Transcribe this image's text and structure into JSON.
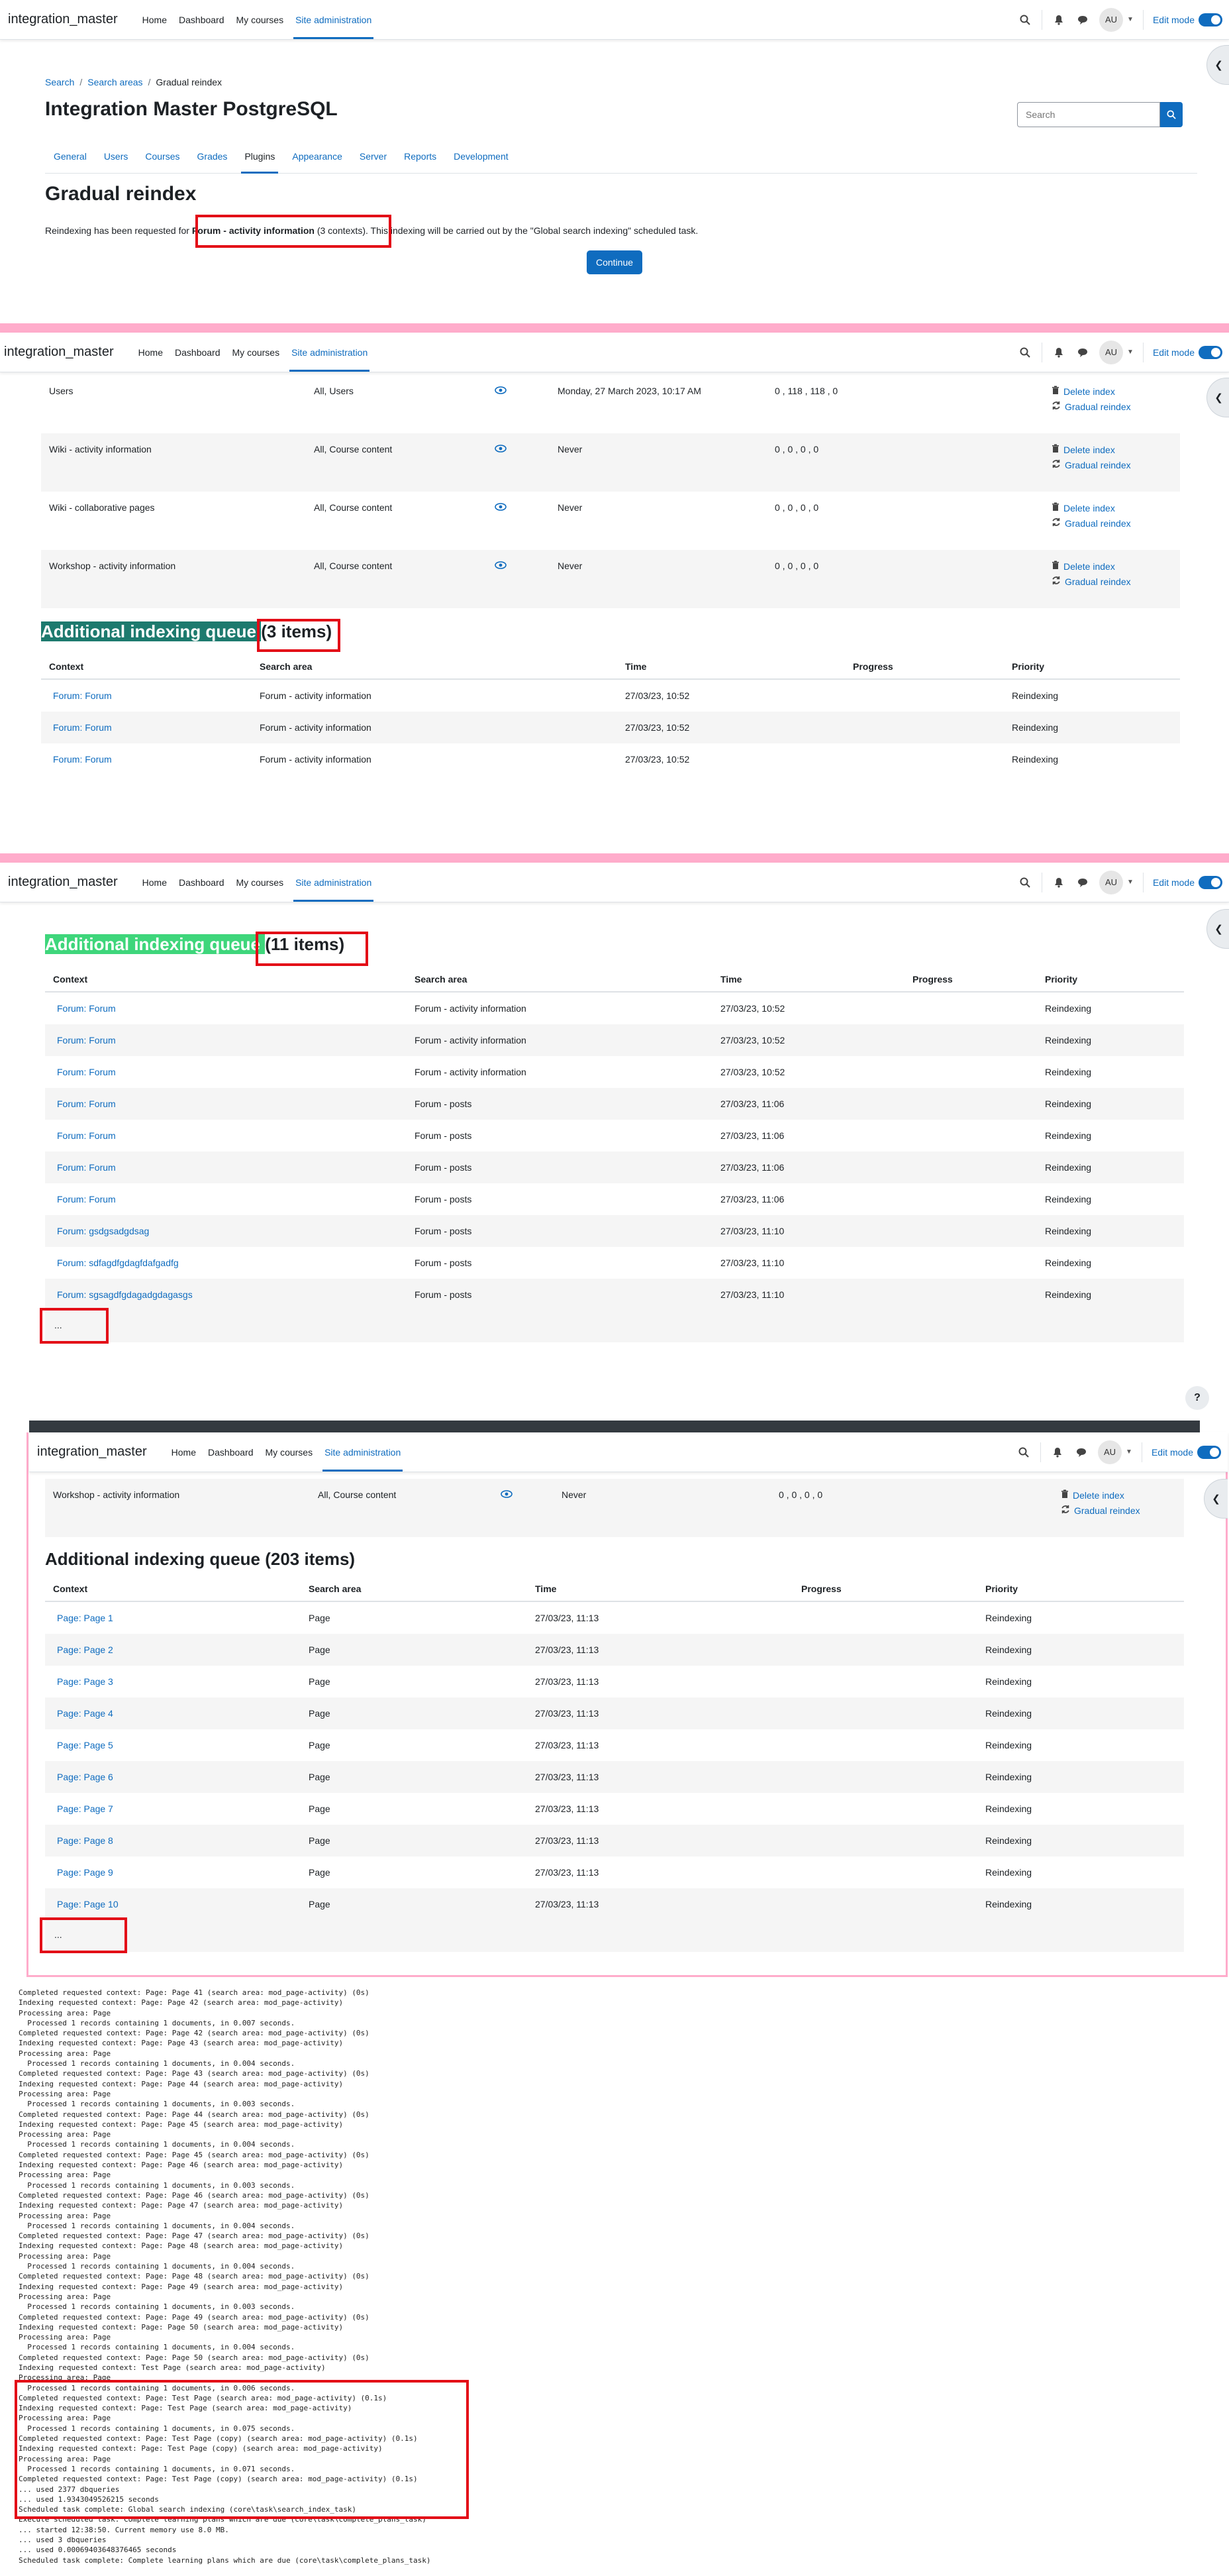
{
  "nav": {
    "brand": "integration_master",
    "links": [
      "Home",
      "Dashboard",
      "My courses",
      "Site administration"
    ],
    "avatar": "AU",
    "edit_mode": "Edit mode"
  },
  "breadcrumb": [
    "Search",
    "Search areas",
    "Gradual reindex"
  ],
  "page_title": "Integration Master PostgreSQL",
  "search": {
    "placeholder": "Search"
  },
  "secondary_nav": [
    "General",
    "Users",
    "Courses",
    "Grades",
    "Plugins",
    "Appearance",
    "Server",
    "Reports",
    "Development"
  ],
  "gradual": {
    "title": "Gradual reindex",
    "msg_pre": "Reindexing has been requested for ",
    "msg_area": "Forum - activity information",
    "msg_contexts": " (3 contexts)",
    "msg_post": ". This indexing will be carried out by the \"Global search indexing\" scheduled task.",
    "continue": "Continue"
  },
  "actions": {
    "delete": "Delete index",
    "gradual": "Gradual reindex"
  },
  "area_rows": [
    {
      "area": "Users",
      "enabled": "All, Users",
      "last": "Monday, 27 March 2023, 10:17 AM",
      "counts": "0 , 118 , 118 , 0"
    },
    {
      "area": "Wiki - activity information",
      "enabled": "All, Course content",
      "last": "Never",
      "counts": "0 , 0 , 0 , 0"
    },
    {
      "area": "Wiki - collaborative pages",
      "enabled": "All, Course content",
      "last": "Never",
      "counts": "0 , 0 , 0 , 0"
    },
    {
      "area": "Workshop - activity information",
      "enabled": "All, Course content",
      "last": "Never",
      "counts": "0 , 0 , 0 , 0"
    }
  ],
  "queue_headers": [
    "Context",
    "Search area",
    "Time",
    "Progress",
    "Priority"
  ],
  "queue1": {
    "title_pre": "Additional indexing queue ",
    "title_count": "(3 items)",
    "rows": [
      {
        "context": "Forum: Forum",
        "area": "Forum - activity information",
        "time": "27/03/23, 10:52",
        "progress": "",
        "priority": "Reindexing"
      },
      {
        "context": "Forum: Forum",
        "area": "Forum - activity information",
        "time": "27/03/23, 10:52",
        "progress": "",
        "priority": "Reindexing"
      },
      {
        "context": "Forum: Forum",
        "area": "Forum - activity information",
        "time": "27/03/23, 10:52",
        "progress": "",
        "priority": "Reindexing"
      }
    ]
  },
  "queue2": {
    "title_pre": "Additional indexing queue ",
    "title_count": "(11 items)",
    "rows": [
      {
        "context": "Forum: Forum",
        "area": "Forum - activity information",
        "time": "27/03/23, 10:52",
        "progress": "",
        "priority": "Reindexing"
      },
      {
        "context": "Forum: Forum",
        "area": "Forum - activity information",
        "time": "27/03/23, 10:52",
        "progress": "",
        "priority": "Reindexing"
      },
      {
        "context": "Forum: Forum",
        "area": "Forum - activity information",
        "time": "27/03/23, 10:52",
        "progress": "",
        "priority": "Reindexing"
      },
      {
        "context": "Forum: Forum",
        "area": "Forum - posts",
        "time": "27/03/23, 11:06",
        "progress": "",
        "priority": "Reindexing"
      },
      {
        "context": "Forum: Forum",
        "area": "Forum - posts",
        "time": "27/03/23, 11:06",
        "progress": "",
        "priority": "Reindexing"
      },
      {
        "context": "Forum: Forum",
        "area": "Forum - posts",
        "time": "27/03/23, 11:06",
        "progress": "",
        "priority": "Reindexing"
      },
      {
        "context": "Forum: Forum",
        "area": "Forum - posts",
        "time": "27/03/23, 11:06",
        "progress": "",
        "priority": "Reindexing"
      },
      {
        "context": "Forum: gsdgsadgdsag",
        "area": "Forum - posts",
        "time": "27/03/23, 11:10",
        "progress": "",
        "priority": "Reindexing"
      },
      {
        "context": "Forum: sdfagdfgdagfdafgadfg",
        "area": "Forum - posts",
        "time": "27/03/23, 11:10",
        "progress": "",
        "priority": "Reindexing"
      },
      {
        "context": "Forum: sgsagdfgdagadgdagasgs",
        "area": "Forum - posts",
        "time": "27/03/23, 11:10",
        "progress": "",
        "priority": "Reindexing"
      }
    ],
    "more": "..."
  },
  "queue3": {
    "title": "Additional indexing queue (203 items)",
    "rows": [
      {
        "context": "Page: Page 1",
        "area": "Page",
        "time": "27/03/23, 11:13",
        "progress": "",
        "priority": "Reindexing"
      },
      {
        "context": "Page: Page 2",
        "area": "Page",
        "time": "27/03/23, 11:13",
        "progress": "",
        "priority": "Reindexing"
      },
      {
        "context": "Page: Page 3",
        "area": "Page",
        "time": "27/03/23, 11:13",
        "progress": "",
        "priority": "Reindexing"
      },
      {
        "context": "Page: Page 4",
        "area": "Page",
        "time": "27/03/23, 11:13",
        "progress": "",
        "priority": "Reindexing"
      },
      {
        "context": "Page: Page 5",
        "area": "Page",
        "time": "27/03/23, 11:13",
        "progress": "",
        "priority": "Reindexing"
      },
      {
        "context": "Page: Page 6",
        "area": "Page",
        "time": "27/03/23, 11:13",
        "progress": "",
        "priority": "Reindexing"
      },
      {
        "context": "Page: Page 7",
        "area": "Page",
        "time": "27/03/23, 11:13",
        "progress": "",
        "priority": "Reindexing"
      },
      {
        "context": "Page: Page 8",
        "area": "Page",
        "time": "27/03/23, 11:13",
        "progress": "",
        "priority": "Reindexing"
      },
      {
        "context": "Page: Page 9",
        "area": "Page",
        "time": "27/03/23, 11:13",
        "progress": "",
        "priority": "Reindexing"
      },
      {
        "context": "Page: Page 10",
        "area": "Page",
        "time": "27/03/23, 11:13",
        "progress": "",
        "priority": "Reindexing"
      }
    ],
    "more": "..."
  },
  "help": "?",
  "log_lines": [
    "Completed requested context: Page: Page 41 (search area: mod_page-activity) (0s)",
    "Indexing requested context: Page: Page 42 (search area: mod_page-activity)",
    "Processing area: Page",
    "  Processed 1 records containing 1 documents, in 0.007 seconds.",
    "Completed requested context: Page: Page 42 (search area: mod_page-activity) (0s)",
    "Indexing requested context: Page: Page 43 (search area: mod_page-activity)",
    "Processing area: Page",
    "  Processed 1 records containing 1 documents, in 0.004 seconds.",
    "Completed requested context: Page: Page 43 (search area: mod_page-activity) (0s)",
    "Indexing requested context: Page: Page 44 (search area: mod_page-activity)",
    "Processing area: Page",
    "  Processed 1 records containing 1 documents, in 0.003 seconds.",
    "Completed requested context: Page: Page 44 (search area: mod_page-activity) (0s)",
    "Indexing requested context: Page: Page 45 (search area: mod_page-activity)",
    "Processing area: Page",
    "  Processed 1 records containing 1 documents, in 0.004 seconds.",
    "Completed requested context: Page: Page 45 (search area: mod_page-activity) (0s)",
    "Indexing requested context: Page: Page 46 (search area: mod_page-activity)",
    "Processing area: Page",
    "  Processed 1 records containing 1 documents, in 0.003 seconds.",
    "Completed requested context: Page: Page 46 (search area: mod_page-activity) (0s)",
    "Indexing requested context: Page: Page 47 (search area: mod_page-activity)",
    "Processing area: Page",
    "  Processed 1 records containing 1 documents, in 0.004 seconds.",
    "Completed requested context: Page: Page 47 (search area: mod_page-activity) (0s)",
    "Indexing requested context: Page: Page 48 (search area: mod_page-activity)",
    "Processing area: Page",
    "  Processed 1 records containing 1 documents, in 0.004 seconds.",
    "Completed requested context: Page: Page 48 (search area: mod_page-activity) (0s)",
    "Indexing requested context: Page: Page 49 (search area: mod_page-activity)",
    "Processing area: Page",
    "  Processed 1 records containing 1 documents, in 0.003 seconds.",
    "Completed requested context: Page: Page 49 (search area: mod_page-activity) (0s)",
    "Indexing requested context: Page: Page 50 (search area: mod_page-activity)",
    "Processing area: Page",
    "  Processed 1 records containing 1 documents, in 0.004 seconds.",
    "Completed requested context: Page: Page 50 (search area: mod_page-activity) (0s)",
    "Indexing requested context: Test Page (search area: mod_page-activity)",
    "Processing area: Page",
    "  Processed 1 records containing 1 documents, in 0.006 seconds.",
    "Completed requested context: Page: Test Page (search area: mod_page-activity) (0.1s)",
    "Indexing requested context: Page: Test Page (search area: mod_page-activity)",
    "Processing area: Page",
    "  Processed 1 records containing 1 documents, in 0.075 seconds.",
    "Completed requested context: Page: Test Page (copy) (search area: mod_page-activity) (0.1s)",
    "Indexing requested context: Page: Test Page (copy) (search area: mod_page-activity)",
    "Processing area: Page",
    "  Processed 1 records containing 1 documents, in 0.071 seconds.",
    "Completed requested context: Page: Test Page (copy) (search area: mod_page-activity) (0.1s)",
    "... used 2377 dbqueries",
    "... used 1.9343049526215 seconds",
    "Scheduled task complete: Global search indexing (core\\task\\search_index_task)",
    "Execute scheduled task: Complete learning plans which are due (core\\task\\complete_plans_task)",
    "... started 12:38:50. Current memory use 8.0 MB.",
    "... used 3 dbqueries",
    "... used 0.00069403648376465 seconds",
    "Scheduled task complete: Complete learning plans which are due (core\\task\\complete_plans_task)"
  ]
}
